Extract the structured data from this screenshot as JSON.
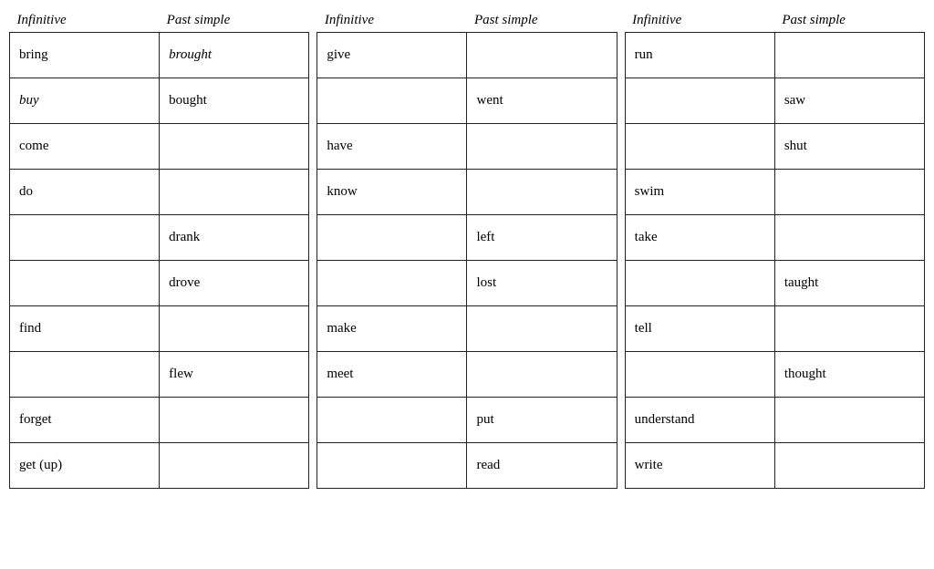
{
  "tables": [
    {
      "headers": [
        "Infinitive",
        "Past simple"
      ],
      "rows": [
        {
          "infinitive": "bring",
          "infinitive_italic": false,
          "past": "brought",
          "past_italic": true
        },
        {
          "infinitive": "buy",
          "infinitive_italic": true,
          "past": "bought",
          "past_italic": false
        },
        {
          "infinitive": "come",
          "infinitive_italic": false,
          "past": "",
          "past_italic": false
        },
        {
          "infinitive": "do",
          "infinitive_italic": false,
          "past": "",
          "past_italic": false
        },
        {
          "infinitive": "",
          "infinitive_italic": false,
          "past": "drank",
          "past_italic": false
        },
        {
          "infinitive": "",
          "infinitive_italic": false,
          "past": "drove",
          "past_italic": false
        },
        {
          "infinitive": "find",
          "infinitive_italic": false,
          "past": "",
          "past_italic": false
        },
        {
          "infinitive": "",
          "infinitive_italic": false,
          "past": "flew",
          "past_italic": false
        },
        {
          "infinitive": "forget",
          "infinitive_italic": false,
          "past": "",
          "past_italic": false
        },
        {
          "infinitive": "get (up)",
          "infinitive_italic": false,
          "past": "",
          "past_italic": false
        }
      ]
    },
    {
      "headers": [
        "Infinitive",
        "Past simple"
      ],
      "rows": [
        {
          "infinitive": "give",
          "infinitive_italic": false,
          "past": "",
          "past_italic": false
        },
        {
          "infinitive": "",
          "infinitive_italic": false,
          "past": "went",
          "past_italic": false
        },
        {
          "infinitive": "have",
          "infinitive_italic": false,
          "past": "",
          "past_italic": false
        },
        {
          "infinitive": "know",
          "infinitive_italic": false,
          "past": "",
          "past_italic": false
        },
        {
          "infinitive": "",
          "infinitive_italic": false,
          "past": "left",
          "past_italic": false
        },
        {
          "infinitive": "",
          "infinitive_italic": false,
          "past": "lost",
          "past_italic": false
        },
        {
          "infinitive": "make",
          "infinitive_italic": false,
          "past": "",
          "past_italic": false
        },
        {
          "infinitive": "meet",
          "infinitive_italic": false,
          "past": "",
          "past_italic": false
        },
        {
          "infinitive": "",
          "infinitive_italic": false,
          "past": "put",
          "past_italic": false
        },
        {
          "infinitive": "",
          "infinitive_italic": false,
          "past": "read",
          "past_italic": false
        }
      ]
    },
    {
      "headers": [
        "Infinitive",
        "Past simple"
      ],
      "rows": [
        {
          "infinitive": "run",
          "infinitive_italic": false,
          "past": "",
          "past_italic": false
        },
        {
          "infinitive": "",
          "infinitive_italic": false,
          "past": "saw",
          "past_italic": false
        },
        {
          "infinitive": "",
          "infinitive_italic": false,
          "past": "shut",
          "past_italic": false
        },
        {
          "infinitive": "swim",
          "infinitive_italic": false,
          "past": "",
          "past_italic": false
        },
        {
          "infinitive": "take",
          "infinitive_italic": false,
          "past": "",
          "past_italic": false
        },
        {
          "infinitive": "",
          "infinitive_italic": false,
          "past": "taught",
          "past_italic": false
        },
        {
          "infinitive": "tell",
          "infinitive_italic": false,
          "past": "",
          "past_italic": false
        },
        {
          "infinitive": "",
          "infinitive_italic": false,
          "past": "thought",
          "past_italic": false
        },
        {
          "infinitive": "understand",
          "infinitive_italic": false,
          "past": "",
          "past_italic": false
        },
        {
          "infinitive": "write",
          "infinitive_italic": false,
          "past": "",
          "past_italic": false
        }
      ]
    }
  ]
}
